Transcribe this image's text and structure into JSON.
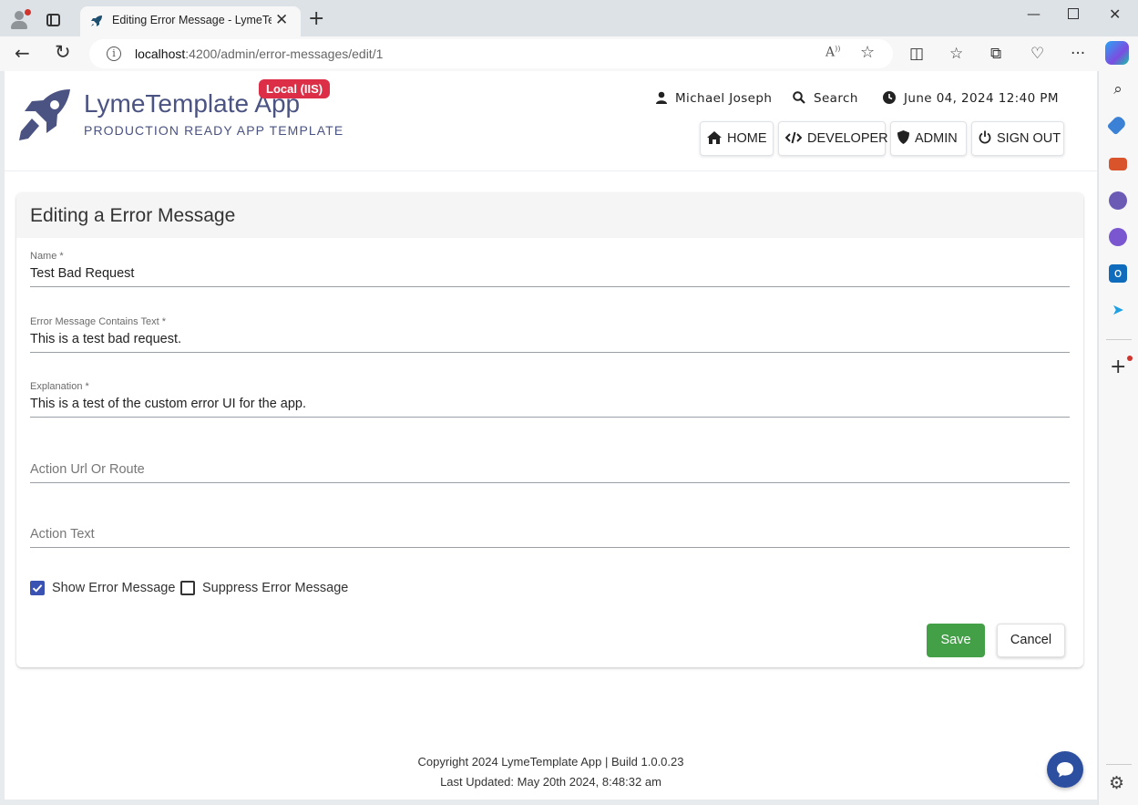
{
  "browser": {
    "tab_title": "Editing Error Message - LymeTem",
    "tab_close": "✕",
    "new_tab": "+",
    "url_host": "localhost",
    "url_path": ":4200/admin/error-messages/edit/1",
    "window_minimize": "—",
    "window_close": "✕"
  },
  "app": {
    "brand": "LymeTemplate App",
    "tagline": "PRODUCTION READY APP TEMPLATE",
    "env_badge": "Local (IIS)",
    "brand_color": "#4b5382",
    "badge_color": "#dc2e46",
    "user_name": "Michael Joseph",
    "search_label": "Search",
    "datetime": "June 04, 2024 12:40 PM",
    "nav": {
      "home": "HOME",
      "developer": "DEVELOPER",
      "admin": "ADMIN",
      "sign_out": "SIGN OUT"
    }
  },
  "form": {
    "title": "Editing a Error Message",
    "name_label": "Name *",
    "name_value": "Test Bad Request",
    "contains_label": "Error Message Contains Text *",
    "contains_value": "This is a test bad request.",
    "explanation_label": "Explanation *",
    "explanation_value": "This is a test of the custom error UI for the app.",
    "action_url_placeholder": "Action Url Or Route",
    "action_text_placeholder": "Action Text",
    "show_error_label": "Show Error Message",
    "show_error_checked": true,
    "suppress_error_label": "Suppress Error Message",
    "suppress_error_checked": false,
    "save_label": "Save",
    "cancel_label": "Cancel",
    "save_color": "#43a047",
    "checkbox_color": "#3a52b2"
  },
  "footer": {
    "copyright": "Copyright 2024 LymeTemplate App | Build 1.0.0.23",
    "last_updated": "Last Updated: May 20th 2024, 8:48:32 am"
  }
}
